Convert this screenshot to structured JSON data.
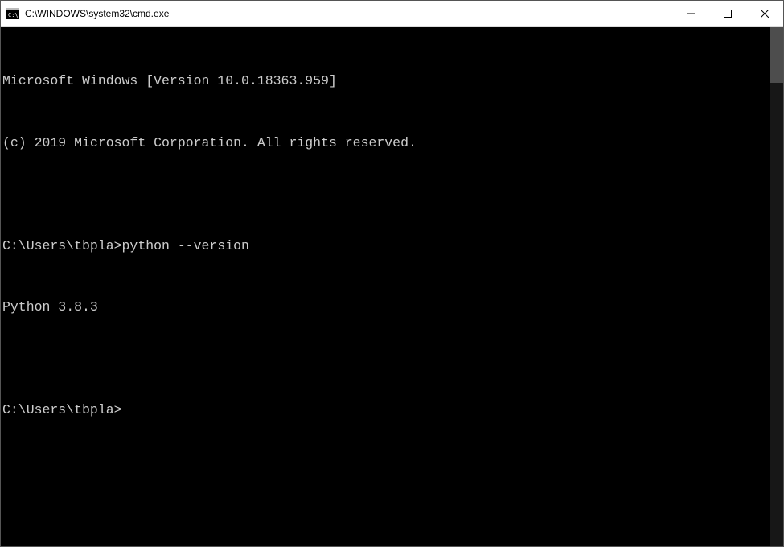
{
  "window": {
    "title": "C:\\WINDOWS\\system32\\cmd.exe"
  },
  "terminal": {
    "line1": "Microsoft Windows [Version 10.0.18363.959]",
    "line2": "(c) 2019 Microsoft Corporation. All rights reserved.",
    "blank1": "",
    "prompt1_path": "C:\\Users\\tbpla>",
    "prompt1_command": "python --version",
    "output1": "Python 3.8.3",
    "blank2": "",
    "prompt2_path": "C:\\Users\\tbpla>"
  }
}
